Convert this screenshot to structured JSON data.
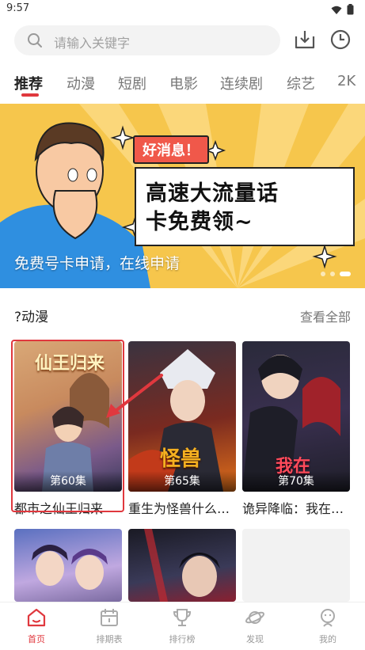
{
  "status_bar": {
    "time": "9:57",
    "wifi_icon": "wifi-icon",
    "battery_icon": "battery-icon"
  },
  "search": {
    "placeholder": "请输入关键字",
    "download_icon": "download-icon",
    "history_icon": "clock-icon"
  },
  "tabs": [
    {
      "label": "推荐",
      "active": true
    },
    {
      "label": "动漫",
      "active": false
    },
    {
      "label": "短剧",
      "active": false
    },
    {
      "label": "电影",
      "active": false
    },
    {
      "label": "连续剧",
      "active": false
    },
    {
      "label": "综艺",
      "active": false
    },
    {
      "label": "2K",
      "active": false
    }
  ],
  "banner": {
    "caption": "免费号卡申请，在线申请",
    "badge": "好消息！",
    "headline_line1": "高速大流量话",
    "headline_line2": "卡免费领~",
    "slide_count": 3,
    "active_slide": 3
  },
  "section": {
    "title": "?动漫",
    "see_all": "查看全部",
    "items": [
      {
        "title": "都市之仙王归来",
        "episode": "第60集",
        "cover_title": "仙王归来"
      },
      {
        "title": "重生为怪兽什么…",
        "episode": "第65集",
        "cover_title": "怪兽"
      },
      {
        "title": "诡异降临：我在…",
        "episode": "第70集",
        "cover_title": "我在"
      },
      {
        "title": "",
        "episode": "",
        "cover_title": ""
      },
      {
        "title": "",
        "episode": "",
        "cover_title": ""
      }
    ]
  },
  "bottom_nav": [
    {
      "label": "首页",
      "icon": "home-icon",
      "active": true
    },
    {
      "label": "排期表",
      "icon": "calendar-icon",
      "active": false
    },
    {
      "label": "排行榜",
      "icon": "trophy-icon",
      "active": false
    },
    {
      "label": "发现",
      "icon": "planet-icon",
      "active": false
    },
    {
      "label": "我的",
      "icon": "user-icon",
      "active": false
    }
  ],
  "colors": {
    "accent": "#e0383e",
    "banner_bg": "#f6c64c"
  }
}
